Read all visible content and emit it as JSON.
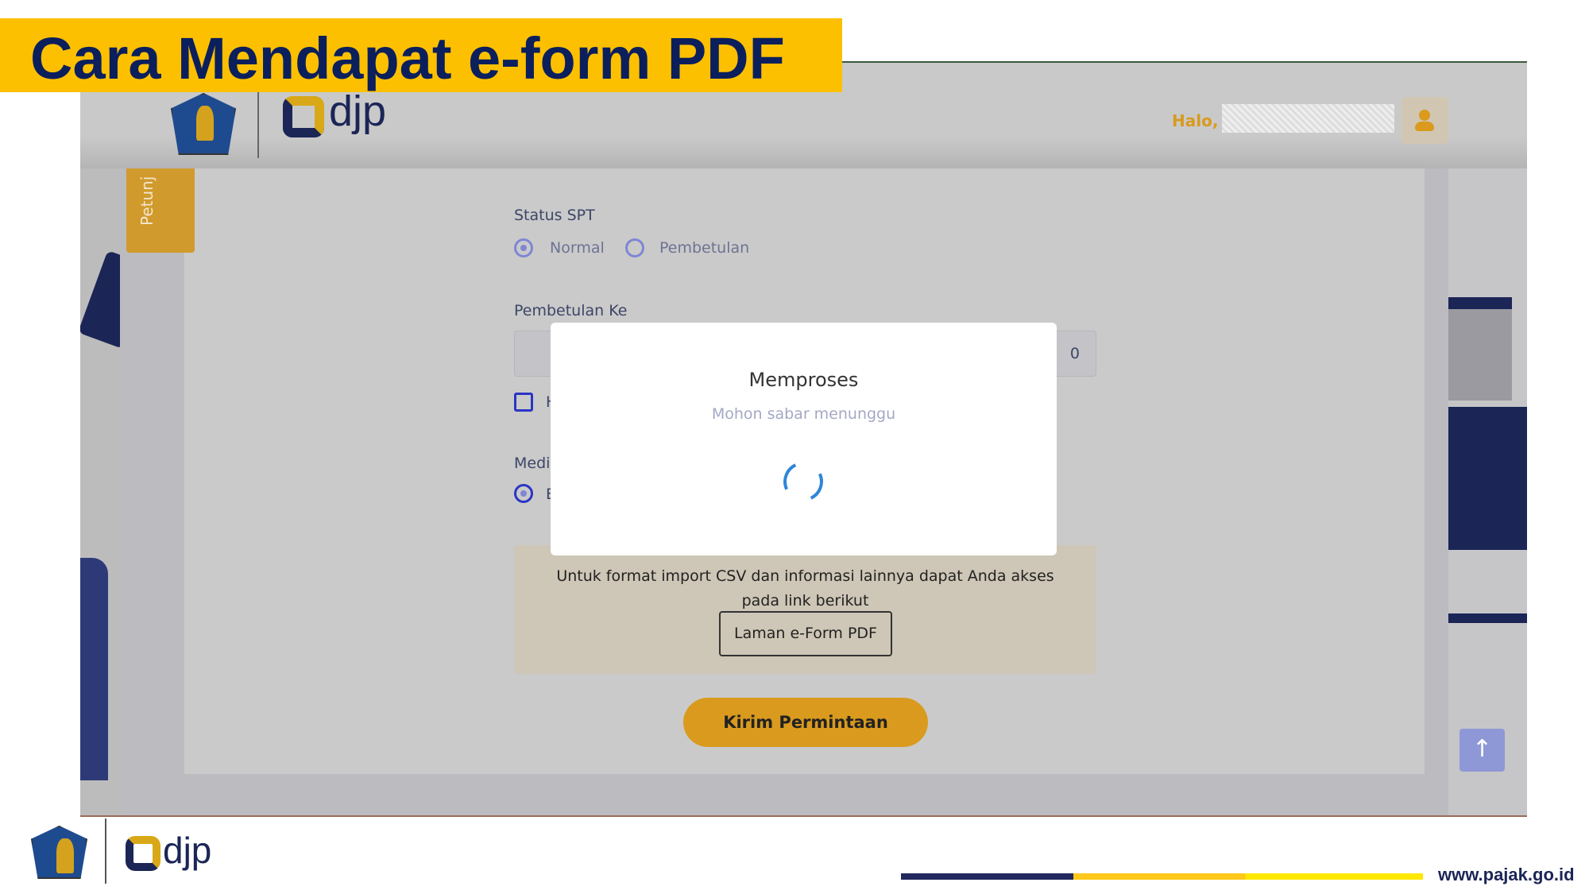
{
  "slide": {
    "title": "Cara Mendapat e-form PDF",
    "footer_url": "www.pajak.go.id",
    "footer_logo_text": "djp"
  },
  "header": {
    "logo_text": "djp",
    "greeting": "Halo,",
    "user_name_redacted": true
  },
  "sidebar_tab": {
    "label": "Petunj"
  },
  "form": {
    "status_spt": {
      "label": "Status SPT",
      "options": [
        {
          "label": "Normal",
          "selected": true
        },
        {
          "label": "Pembetulan",
          "selected": false
        }
      ]
    },
    "pembetulan_ke": {
      "label": "Pembetulan Ke",
      "value": "0"
    },
    "checkbox_partial": "H",
    "media_label_partial": "Medi",
    "media_option_partial": "E",
    "info": {
      "line1": "Untuk format import CSV dan informasi lainnya dapat Anda akses",
      "line2": "pada link berikut",
      "link_button": "Laman e-Form PDF"
    },
    "submit_button": "Kirim Permintaan"
  },
  "modal": {
    "title": "Memproses",
    "subtitle": "Mohon sabar menunggu"
  },
  "colors": {
    "accent": "#d99a1e",
    "navy": "#1b2556",
    "banner": "#fdc001"
  }
}
